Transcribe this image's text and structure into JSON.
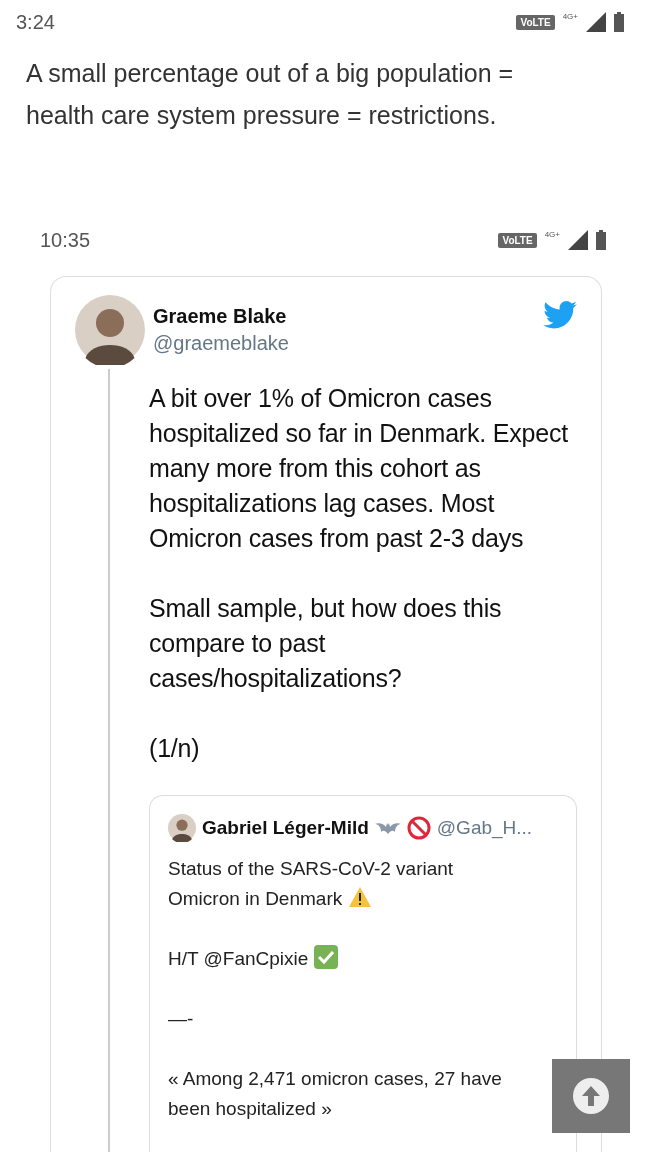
{
  "status_bar": {
    "time": "3:24",
    "network_badge": "VoLTE",
    "network_type": "4G+"
  },
  "post": {
    "text": "A small percentage out of a big population = health care system pressure = restrictions."
  },
  "screenshot": {
    "status_bar": {
      "time": "10:35",
      "network_badge": "VoLTE",
      "network_type": "4G+"
    },
    "tweet": {
      "author": "Graeme Blake",
      "handle": "@graemeblake",
      "paragraphs": [
        "A bit over 1% of Omicron cases hospitalized so far in Denmark. Expect many more from this cohort as hospitalizations lag cases. Most Omicron cases from past 2-3 days",
        "Small sample, but how does this compare to past cases/hospitalizations?",
        "(1/n)"
      ],
      "quoted": {
        "author": "Gabriel Léger-Mild",
        "handle": "@Gab_H...",
        "paragraphs": [
          {
            "text": "Status of the SARS-CoV-2 variant Omicron in Denmark",
            "kind": "warning"
          },
          {
            "text": "H/T @FanCpixie",
            "kind": "check"
          },
          {
            "text": "—-",
            "kind": "plain"
          },
          {
            "text": "« Among 2,471 omicron cases, 27 have been hospitalized »",
            "kind": "plain"
          }
        ]
      }
    }
  }
}
